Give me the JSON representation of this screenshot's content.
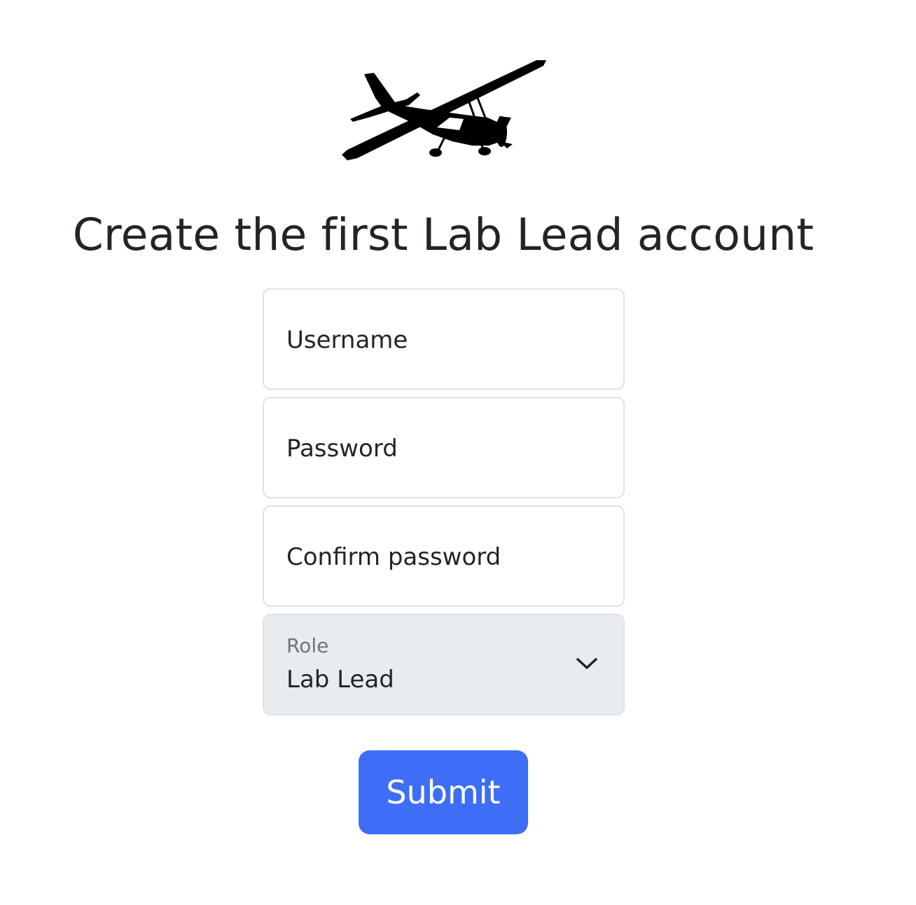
{
  "logo": {
    "icon": "airplane-icon"
  },
  "title": "Create the first Lab Lead account",
  "form": {
    "username_placeholder": "Username",
    "password_placeholder": "Password",
    "confirm_placeholder": "Confirm password",
    "role": {
      "label": "Role",
      "value": "Lab Lead"
    },
    "submit_label": "Submit"
  },
  "colors": {
    "accent": "#3d6ef5",
    "text": "#212529",
    "border": "#dee2e6",
    "select_bg": "#e9ecef",
    "muted": "#6c757d"
  }
}
